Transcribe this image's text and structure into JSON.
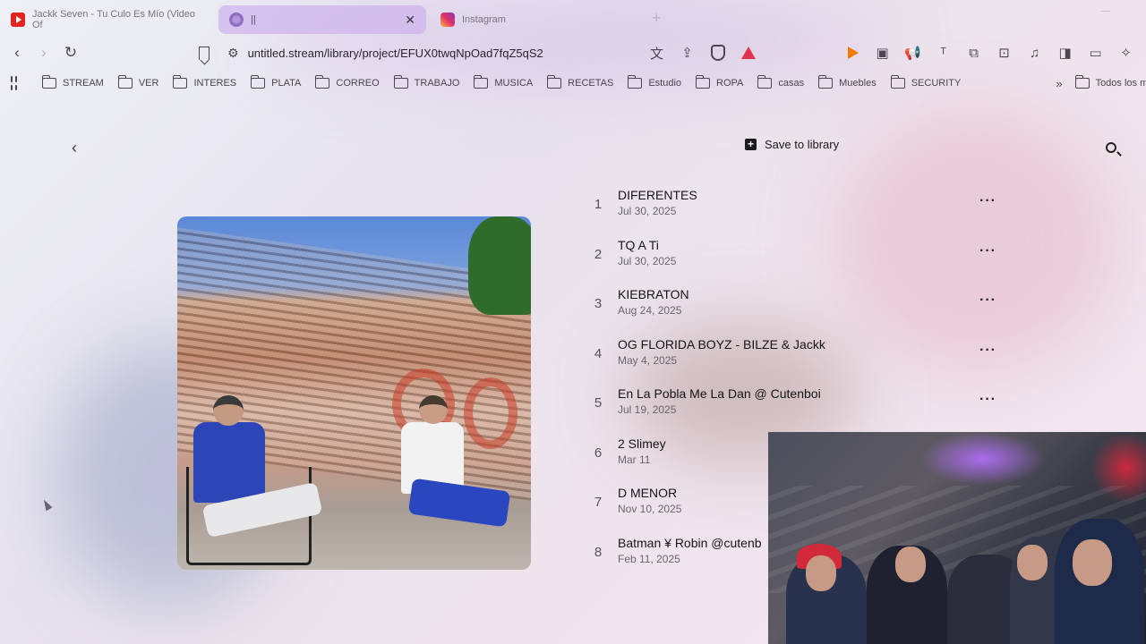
{
  "tabs": [
    {
      "title": "Jackk Seven - Tu Culo Es Mío (Video Of",
      "icon": "youtube-icon"
    },
    {
      "title": "||",
      "icon": "site-icon",
      "active": true
    },
    {
      "title": "Instagram",
      "icon": "instagram-icon"
    }
  ],
  "address": {
    "url": "untitled.stream/library/project/EFUX0twqNpOad7fqZ5qS2"
  },
  "bookmarks": {
    "items": [
      "STREAM",
      "VER",
      "INTERES",
      "PLATA",
      "CORREO",
      "TRABAJO",
      "MUSICA",
      "RECETAS",
      "Estudio",
      "ROPA",
      "casas",
      "Muebles",
      "SECURITY"
    ],
    "overflow": "Todos los m"
  },
  "page": {
    "save_label": "Save to library"
  },
  "tracks": [
    {
      "num": "1",
      "title": "DIFERENTES",
      "date": "Jul 30, 2025"
    },
    {
      "num": "2",
      "title": "TQ A Ti",
      "date": "Jul 30, 2025"
    },
    {
      "num": "3",
      "title": "KIEBRATON",
      "date": "Aug 24, 2025"
    },
    {
      "num": "4",
      "title": "OG FLORIDA BOYZ - BILZE & Jackk",
      "date": "May 4, 2025"
    },
    {
      "num": "5",
      "title": "En La Pobla Me La Dan @ Cutenboi",
      "date": "Jul 19, 2025"
    },
    {
      "num": "6",
      "title": "2 Slimey",
      "date": "Mar 11"
    },
    {
      "num": "7",
      "title": "D MENOR",
      "date": "Nov 10, 2025"
    },
    {
      "num": "8",
      "title": "Batman ¥ Robin @cutenb",
      "date": "Feb 11, 2025"
    }
  ],
  "colors": {
    "active_tab": "#ceb4ec",
    "accent_orange": "#f07b00",
    "brave_red": "#e0344f"
  }
}
